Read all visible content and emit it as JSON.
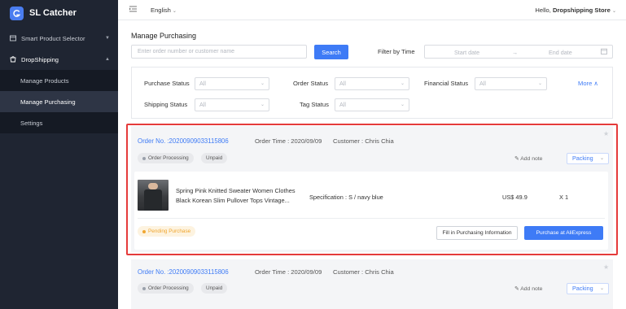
{
  "app": {
    "name": "SL Catcher",
    "logo_letter": "G"
  },
  "sidebar": {
    "items": [
      {
        "label": "Smart Product Selector",
        "icon": "box-icon"
      },
      {
        "label": "DropShipping",
        "icon": "cart-icon"
      }
    ],
    "sub_items": [
      {
        "label": "Manage Products"
      },
      {
        "label": "Manage Purchasing"
      },
      {
        "label": "Settings"
      }
    ]
  },
  "topbar": {
    "language": "English",
    "hello_prefix": "Hello,",
    "store_name": "Dropshipping Store"
  },
  "page": {
    "title": "Manage Purchasing",
    "search_placeholder": "Enter order number or customer name",
    "search_button": "Search",
    "filter_by_time": "Filter by Time",
    "start_date": "Start date",
    "date_arrow": "→",
    "end_date": "End date"
  },
  "filters": {
    "purchase_status_label": "Purchase Status",
    "order_status_label": "Order Status",
    "financial_status_label": "Financial Status",
    "shipping_status_label": "Shipping Status",
    "tag_status_label": "Tag Status",
    "all": "All",
    "more": "More ∧"
  },
  "orders": [
    {
      "order_no": "Order No. :20200909033115806",
      "order_time": "Order Time : 2020/09/09",
      "customer": "Customer :  Chris Chia",
      "status_tag": "Order Processing",
      "payment_tag": "Unpaid",
      "add_note": "Add note",
      "packing": "Packing",
      "item": {
        "title": "Spring Pink Knitted Sweater Women Clothes Black Korean Slim Pullover Tops Vintage...",
        "specification": "Specification : S / navy blue",
        "price": "US$ 49.9",
        "quantity": "X 1"
      },
      "pending_tag": "Pending Purchase",
      "fill_button": "Fill in Purchasing Information",
      "purchase_button": "Purchase at AliExpress"
    },
    {
      "order_no": "Order No. :20200909033115806",
      "order_time": "Order Time : 2020/09/09",
      "customer": "Customer :  Chris Chia",
      "status_tag": "Order Processing",
      "payment_tag": "Unpaid",
      "add_note": "Add note",
      "packing": "Packing"
    }
  ],
  "colors": {
    "accent": "#3e7bf6",
    "highlight": "#e53b3b",
    "pending": "#f0a630",
    "sidebar": "#1f2532"
  }
}
